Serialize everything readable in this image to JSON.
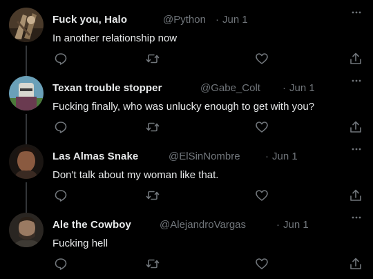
{
  "colors": {
    "background": "#000000",
    "primary_text": "#e7e9ea",
    "secondary_text": "#71767b",
    "thread_line": "#333639"
  },
  "icons": {
    "reply": "reply-icon",
    "retweet": "retweet-icon",
    "like": "like-icon",
    "share": "share-icon",
    "more": "more-icon"
  },
  "tweets": [
    {
      "name": "Fuck you, Halo",
      "handle": "@Python",
      "separator": "·",
      "date": "Jun 1",
      "text": "In another relationship now"
    },
    {
      "name": "Texan trouble stopper",
      "handle": "@Gabe_Colt",
      "separator": "·",
      "date": "Jun 1",
      "text": "Fucking finally, who was unlucky enough to get with you?"
    },
    {
      "name": "Las Almas Snake",
      "handle": "@ElSinNombre",
      "separator": "·",
      "date": "Jun 1",
      "text": "Don't talk about my woman like that."
    },
    {
      "name": "Ale the Cowboy",
      "handle": "@AlejandroVargas",
      "separator": "·",
      "date": "Jun 1",
      "text": "Fucking hell"
    }
  ]
}
